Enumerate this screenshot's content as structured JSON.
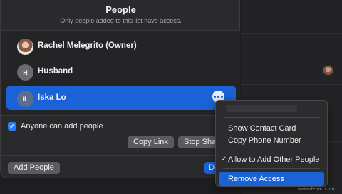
{
  "sheet": {
    "title": "People",
    "subtitle": "Only people added to this list have access."
  },
  "people": [
    {
      "name": "Rachel Melegrito (Owner)",
      "initials": "",
      "avatar": "photo"
    },
    {
      "name": "Husband",
      "initials": "H",
      "avatar": "initials"
    },
    {
      "name": "Iska Lo",
      "initials": "IL",
      "avatar": "initials",
      "selected": true
    }
  ],
  "permissions": {
    "anyone_can_add_label": "Anyone can add people",
    "anyone_can_add_checked": true
  },
  "buttons": {
    "copy_link": "Copy Link",
    "stop_sharing": "Stop Sharing",
    "add_people": "Add People",
    "done": "Done"
  },
  "context_menu": {
    "items": [
      {
        "label": "Show Contact Card"
      },
      {
        "label": "Copy Phone Number"
      },
      {
        "label": "Allow to Add Other People",
        "checked": true
      },
      {
        "label": "Remove Access",
        "highlighted": true
      }
    ]
  },
  "watermark": "www.deuaq.com",
  "colors": {
    "accent": "#1b62d6",
    "sheet_bg": "#2a2a2d",
    "list_bg": "#242427"
  }
}
